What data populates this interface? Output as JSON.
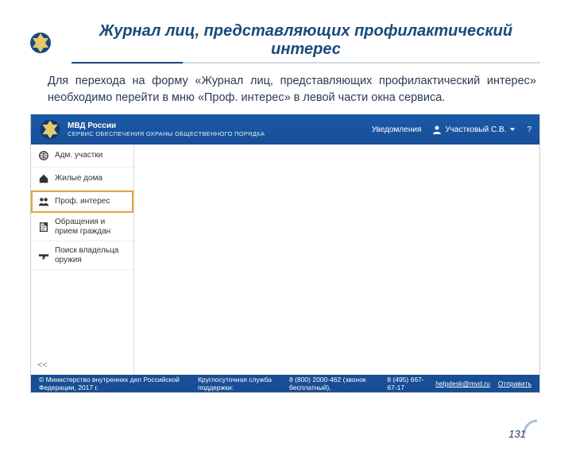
{
  "slide": {
    "title": "Журнал лиц, представляющих профилактический интерес",
    "body": "Для перехода на форму «Журнал лиц, представляющих профилактический интерес» необходимо перейти в мню «Проф. интерес» в левой части окна сервиса.",
    "page_number": "131"
  },
  "app": {
    "header": {
      "title_main": "МВД России",
      "title_sub": "СЕРВИС ОБЕСПЕЧЕНИЯ ОХРАНЫ ОБЩЕСТВЕННОГО ПОРЯДКА",
      "notifications": "Уведомления",
      "user": "Участковый С.В.",
      "help": "?"
    },
    "sidebar": {
      "items": [
        {
          "label": "Адм. участки"
        },
        {
          "label": "Жилые дома"
        },
        {
          "label": "Проф. интерес"
        },
        {
          "label": "Обращения и прием граждан"
        },
        {
          "label": "Поиск владельца оружия"
        }
      ],
      "collapse": "<<"
    },
    "footer": {
      "copyright": "© Министерство внутренних дел Российской Федерации, 2017 г.",
      "support_label": "Круглосуточная служба поддержки:",
      "phone1": "8 (800) 2000-462 (звонок бесплатный),",
      "phone2": "8 (495) 667-67-17",
      "email": "helpdesk@mvd.ru",
      "send": "Отправить"
    }
  }
}
